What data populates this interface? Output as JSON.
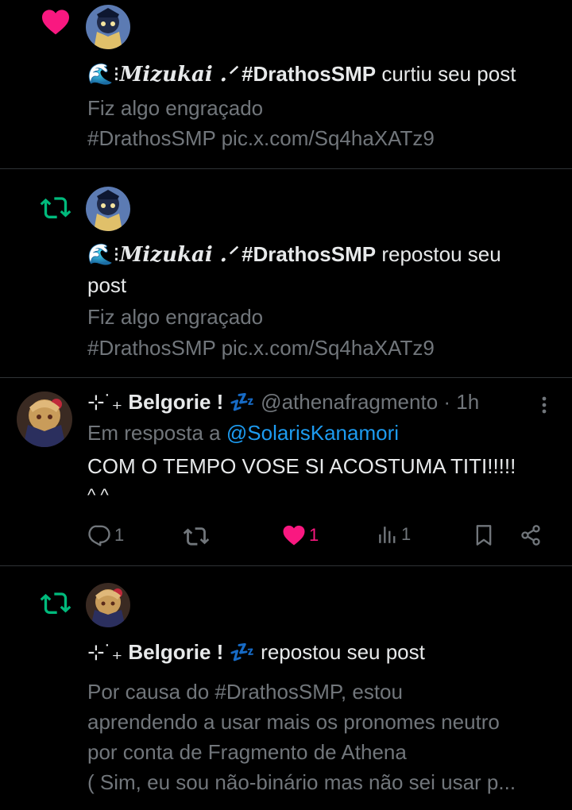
{
  "notifications": [
    {
      "type": "like",
      "icon": "heart-icon",
      "emoji_prefix": "🌊⁝",
      "user_name": "Mizukai .ᐟ",
      "hashtag": "#DrathosSMP",
      "action_text": "curtiu seu post",
      "post_line1": "Fiz algo engraçado",
      "post_line2": "#DrathosSMP pic.x.com/Sq4haXATz9"
    },
    {
      "type": "repost",
      "icon": "repost-icon",
      "emoji_prefix": "🌊⁝",
      "user_name": "Mizukai .ᐟ",
      "hashtag": "#DrathosSMP",
      "action_text_line1": "repostou seu",
      "action_text_line2": "post",
      "post_line1": "Fiz algo engraçado",
      "post_line2": "#DrathosSMP pic.x.com/Sq4haXATz9"
    }
  ],
  "reply": {
    "name_prefix": "⊹˙₊",
    "name": "Belgorie !",
    "sleep_emoji": "💤",
    "handle": "@athenafragmento",
    "separator": "·",
    "time": "1h",
    "reply_prefix": "Em resposta a",
    "reply_to": "@SolarisKanamori",
    "text_line1": "COM O TEMPO VOSE SI ACOSTUMA TITI!!!!!",
    "text_line2": "^ ^",
    "counts": {
      "replies": "1",
      "likes": "1",
      "views": "1"
    }
  },
  "repost2": {
    "name_prefix": "⊹˙₊",
    "name": "Belgorie !",
    "sleep_emoji": "💤",
    "action_text": "repostou seu post",
    "post_lines": [
      "Por causa do #DrathosSMP, estou",
      "aprendendo a usar mais os pronomes neutro",
      "por conta de Fragmento de Athena",
      "( Sim, eu sou não-binário mas não sei usar p..."
    ]
  },
  "colors": {
    "background": "#000000",
    "text": "#e7e9ea",
    "muted": "#71767b",
    "like": "#f91880",
    "repost": "#00ba7c",
    "link": "#1d9bf0",
    "divider": "#2f3336"
  }
}
